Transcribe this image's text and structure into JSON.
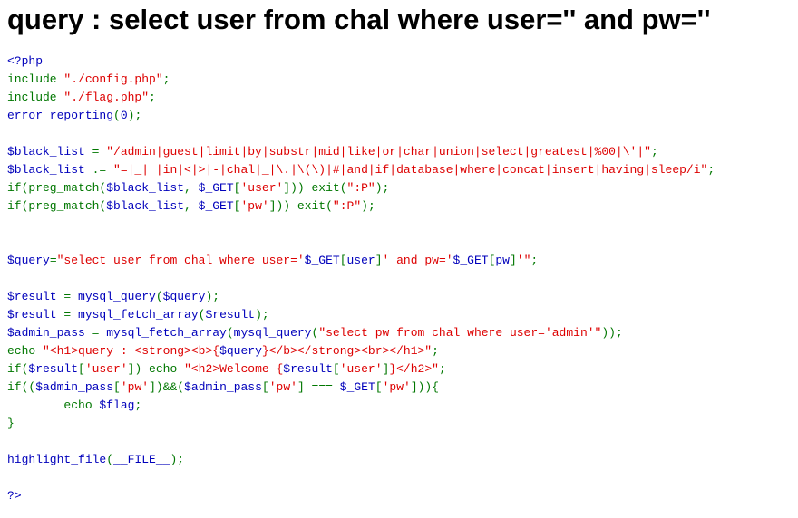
{
  "heading": "query : select user from chal where user='' and pw=''",
  "colors": {
    "default": "#0000BB",
    "keyword": "#007700",
    "string": "#DD0000",
    "html": "#000000"
  },
  "code_lines": [
    [
      [
        "default",
        "<?php"
      ]
    ],
    [
      [
        "keyword",
        "include "
      ],
      [
        "string",
        "\"./config.php\""
      ],
      [
        "keyword",
        ";"
      ]
    ],
    [
      [
        "keyword",
        "include "
      ],
      [
        "string",
        "\"./flag.php\""
      ],
      [
        "keyword",
        ";"
      ]
    ],
    [
      [
        "default",
        "error_reporting"
      ],
      [
        "keyword",
        "("
      ],
      [
        "default",
        "0"
      ],
      [
        "keyword",
        ");"
      ]
    ],
    [],
    [
      [
        "default",
        "$black_list "
      ],
      [
        "keyword",
        "= "
      ],
      [
        "string",
        "\"/admin|guest|limit|by|substr|mid|like|or|char|union|select|greatest|%00|\\'|\""
      ],
      [
        "keyword",
        ";"
      ]
    ],
    [
      [
        "default",
        "$black_list "
      ],
      [
        "keyword",
        ".= "
      ],
      [
        "string",
        "\"=|_| |in|<|>|-|chal|_|\\.|\\(\\)|#|and|if|database|where|concat|insert|having|sleep/i\""
      ],
      [
        "keyword",
        ";"
      ]
    ],
    [
      [
        "keyword",
        "if(preg_match("
      ],
      [
        "default",
        "$black_list"
      ],
      [
        "keyword",
        ", "
      ],
      [
        "default",
        "$_GET"
      ],
      [
        "keyword",
        "["
      ],
      [
        "string",
        "'user'"
      ],
      [
        "keyword",
        "])) exit("
      ],
      [
        "string",
        "\":P\""
      ],
      [
        "keyword",
        ");"
      ]
    ],
    [
      [
        "keyword",
        "if(preg_match("
      ],
      [
        "default",
        "$black_list"
      ],
      [
        "keyword",
        ", "
      ],
      [
        "default",
        "$_GET"
      ],
      [
        "keyword",
        "["
      ],
      [
        "string",
        "'pw'"
      ],
      [
        "keyword",
        "])) exit("
      ],
      [
        "string",
        "\":P\""
      ],
      [
        "keyword",
        ");"
      ]
    ],
    [],
    [],
    [
      [
        "default",
        "$query"
      ],
      [
        "keyword",
        "="
      ],
      [
        "string",
        "\"select user from chal where user='"
      ],
      [
        "default",
        "$_GET"
      ],
      [
        "keyword",
        "["
      ],
      [
        "default",
        "user"
      ],
      [
        "keyword",
        "]"
      ],
      [
        "string",
        "' and pw='"
      ],
      [
        "default",
        "$_GET"
      ],
      [
        "keyword",
        "["
      ],
      [
        "default",
        "pw"
      ],
      [
        "keyword",
        "]"
      ],
      [
        "string",
        "'\""
      ],
      [
        "keyword",
        ";"
      ]
    ],
    [],
    [
      [
        "default",
        "$result "
      ],
      [
        "keyword",
        "= "
      ],
      [
        "default",
        "mysql_query"
      ],
      [
        "keyword",
        "("
      ],
      [
        "default",
        "$query"
      ],
      [
        "keyword",
        ");"
      ]
    ],
    [
      [
        "default",
        "$result "
      ],
      [
        "keyword",
        "= "
      ],
      [
        "default",
        "mysql_fetch_array"
      ],
      [
        "keyword",
        "("
      ],
      [
        "default",
        "$result"
      ],
      [
        "keyword",
        ");"
      ]
    ],
    [
      [
        "default",
        "$admin_pass "
      ],
      [
        "keyword",
        "= "
      ],
      [
        "default",
        "mysql_fetch_array"
      ],
      [
        "keyword",
        "("
      ],
      [
        "default",
        "mysql_query"
      ],
      [
        "keyword",
        "("
      ],
      [
        "string",
        "\"select pw from chal where user='admin'\""
      ],
      [
        "keyword",
        "));"
      ]
    ],
    [
      [
        "keyword",
        "echo "
      ],
      [
        "string",
        "\"<h1>query : <strong><b>{"
      ],
      [
        "default",
        "$query"
      ],
      [
        "string",
        "}</b></strong><br></h1>\""
      ],
      [
        "keyword",
        ";"
      ]
    ],
    [
      [
        "keyword",
        "if("
      ],
      [
        "default",
        "$result"
      ],
      [
        "keyword",
        "["
      ],
      [
        "string",
        "'user'"
      ],
      [
        "keyword",
        "]) echo "
      ],
      [
        "string",
        "\"<h2>Welcome {"
      ],
      [
        "default",
        "$result"
      ],
      [
        "keyword",
        "["
      ],
      [
        "string",
        "'user'"
      ],
      [
        "keyword",
        "]"
      ],
      [
        "string",
        "}</h2>\""
      ],
      [
        "keyword",
        ";"
      ]
    ],
    [
      [
        "keyword",
        "if(("
      ],
      [
        "default",
        "$admin_pass"
      ],
      [
        "keyword",
        "["
      ],
      [
        "string",
        "'pw'"
      ],
      [
        "keyword",
        "])&&("
      ],
      [
        "default",
        "$admin_pass"
      ],
      [
        "keyword",
        "["
      ],
      [
        "string",
        "'pw'"
      ],
      [
        "keyword",
        "] === "
      ],
      [
        "default",
        "$_GET"
      ],
      [
        "keyword",
        "["
      ],
      [
        "string",
        "'pw'"
      ],
      [
        "keyword",
        "])){"
      ]
    ],
    [
      [
        "keyword",
        "        echo "
      ],
      [
        "default",
        "$flag"
      ],
      [
        "keyword",
        ";"
      ]
    ],
    [
      [
        "keyword",
        "}"
      ]
    ],
    [],
    [
      [
        "default",
        "highlight_file"
      ],
      [
        "keyword",
        "("
      ],
      [
        "default",
        "__FILE__"
      ],
      [
        "keyword",
        ");"
      ]
    ],
    [],
    [
      [
        "default",
        "?>"
      ]
    ]
  ]
}
